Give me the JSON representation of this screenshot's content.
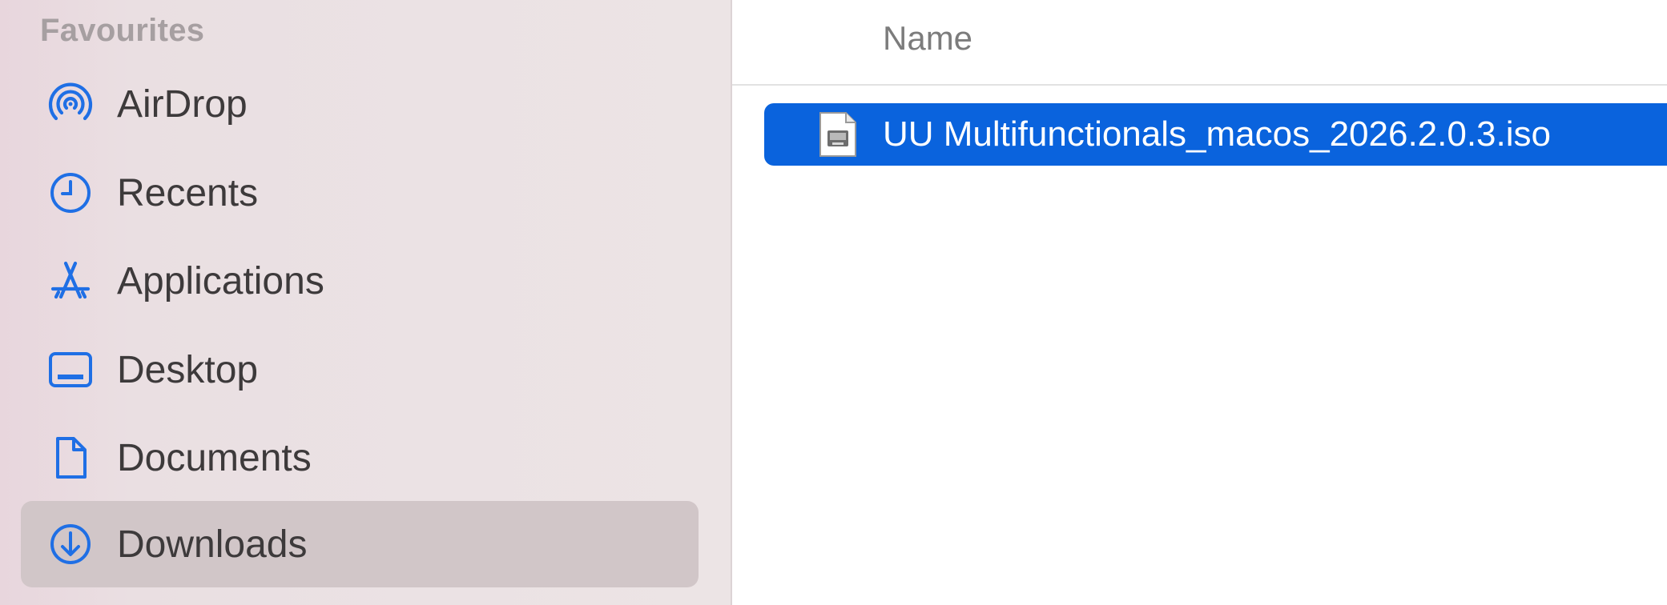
{
  "sidebar": {
    "section_title": "Favourites",
    "items": [
      {
        "label": "AirDrop",
        "icon": "airdrop-icon"
      },
      {
        "label": "Recents",
        "icon": "clock-icon"
      },
      {
        "label": "Applications",
        "icon": "applications-icon"
      },
      {
        "label": "Desktop",
        "icon": "desktop-icon"
      },
      {
        "label": "Documents",
        "icon": "document-icon"
      },
      {
        "label": "Downloads",
        "icon": "download-icon",
        "selected": true
      }
    ]
  },
  "file_list": {
    "column_name": "Name",
    "rows": [
      {
        "name": "UU Multifunctionals_macos_2026.2.0.3.iso",
        "icon": "disk-image-file-icon",
        "selected": true
      }
    ]
  },
  "colors": {
    "accent": "#0a63dd",
    "icon_blue": "#1f6fe5",
    "sidebar_selected": "#d1c6c8"
  }
}
